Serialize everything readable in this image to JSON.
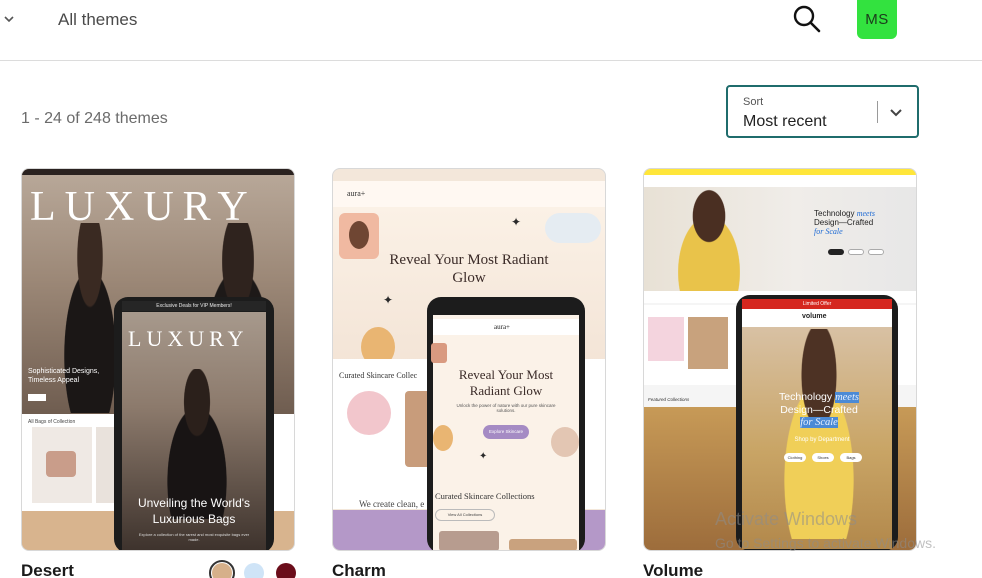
{
  "header": {
    "breadcrumb": "All themes",
    "avatar_initials": "MS",
    "avatar_color": "#33e23f",
    "search_icon": "search-icon",
    "collapse_icon": "chevron-down-icon"
  },
  "results": {
    "count_text": "1 - 24 of 248 themes"
  },
  "sort": {
    "label": "Sort",
    "value": "Most recent",
    "border_color": "#1f6c6c",
    "icon": "chevron-down-icon"
  },
  "themes": [
    {
      "name": "Desert",
      "preview": {
        "title": "LUXURY",
        "tagline": "Sophisticated Designs, Timeless Appeal",
        "collection_label": "All Bags of Collection",
        "phone_banner": "Exclusive Deals for VIP Members!",
        "phone_title": "LUXURY",
        "phone_headline": "Unveiling the World's Luxurious Bags",
        "phone_sub": "Explore a collection of the rarest and most exquisite bags ever made."
      },
      "swatches": [
        "#d6b08a",
        "#cfe4f7",
        "#6b0d1a"
      ]
    },
    {
      "name": "Charm",
      "preview": {
        "logo": "aura+",
        "headline": "Reveal Your Most Radiant Glow",
        "section_title": "Curated Skincare Collec",
        "create_text": "We create clean, e",
        "phone_logo": "aura+",
        "phone_headline": "Reveal Your Most Radiant Glow",
        "phone_sub": "Unlock the power of nature with our pure skincare solutions.",
        "explore_label": "Explore Skincare",
        "phone_section_title": "Curated Skincare Collections",
        "view_label": "View All Collections"
      }
    },
    {
      "name": "Volume",
      "preview": {
        "hero_line1": "Technology",
        "hero_em1": "meets",
        "hero_line2": "Design—Crafted",
        "hero_em2": "for Scale",
        "featured_label": "Featured Collections",
        "phone_banner": "Limited Offer",
        "phone_logo": "volume",
        "phone_line1": "Technology",
        "phone_em1": "meets",
        "phone_line2": "Design—Crafted",
        "phone_em2": "for Scale",
        "phone_shop": "Shop by Department",
        "chips": [
          "Clothing",
          "Shoes",
          "Bags"
        ]
      }
    }
  ],
  "os_watermark": {
    "title": "Activate Windows",
    "subtitle": "Go to Settings to activate Windows."
  }
}
